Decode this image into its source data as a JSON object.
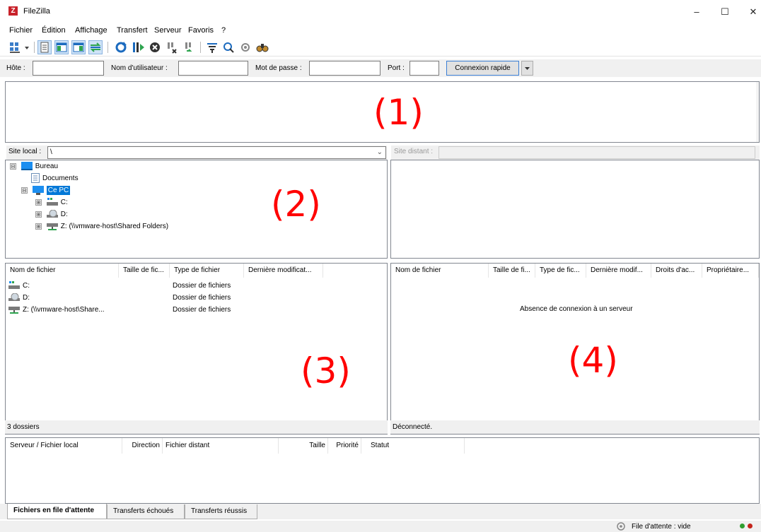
{
  "window": {
    "title": "FileZilla",
    "app_icon_letter": "Z",
    "controls": {
      "minimize": "–",
      "maximize": "☐",
      "close": "✕"
    }
  },
  "menu": [
    "Fichier",
    "Édition",
    "Affichage",
    "Transfert",
    "Serveur",
    "Favoris",
    "?"
  ],
  "toolbar": {
    "icons": [
      "site-manager-icon",
      "toggle-message-log-icon",
      "toggle-local-tree-icon",
      "toggle-remote-tree-icon",
      "toggle-queue-icon",
      "refresh-icon",
      "process-queue-icon",
      "cancel-icon",
      "disconnect-icon",
      "reconnect-icon",
      "directory-filter-icon",
      "compare-directories-icon",
      "sync-browse-icon",
      "search-files-icon"
    ]
  },
  "quickconnect": {
    "host_label": "Hôte :",
    "host_value": "",
    "user_label": "Nom d'utilisateur :",
    "user_value": "",
    "password_label": "Mot de passe :",
    "password_value": "",
    "port_label": "Port :",
    "port_value": "",
    "connect_button": "Connexion rapide"
  },
  "annotations": {
    "log": "(1)",
    "local_tree": "(2)",
    "local_files": "(3)",
    "remote_files": "(4)"
  },
  "local_site": {
    "label": "Site local :",
    "path": "\\",
    "tree": [
      {
        "label": "Bureau",
        "icon": "desktop-icon",
        "expander": "⊟"
      },
      {
        "label": "Documents",
        "icon": "documents-icon",
        "expander": ""
      },
      {
        "label": "Ce PC",
        "icon": "computer-icon",
        "expander": "⊟",
        "selected": true
      },
      {
        "label": "C:",
        "icon": "drive-c-icon",
        "expander": "⊞"
      },
      {
        "label": "D:",
        "icon": "cd-drive-icon",
        "expander": "⊞"
      },
      {
        "label": "Z: (\\\\vmware-host\\Shared Folders)",
        "icon": "network-drive-icon",
        "expander": "⊞"
      }
    ]
  },
  "remote_site": {
    "label": "Site distant :",
    "path": ""
  },
  "local_files": {
    "columns": [
      "Nom de fichier",
      "Taille de fic...",
      "Type de fichier",
      "Dernière modificat..."
    ],
    "rows": [
      {
        "name": "C:",
        "icon": "drive-c-icon",
        "size": "",
        "type": "Dossier de fichiers",
        "modified": ""
      },
      {
        "name": "D:",
        "icon": "cd-drive-icon",
        "size": "",
        "type": "Dossier de fichiers",
        "modified": ""
      },
      {
        "name": "Z: (\\\\vmware-host\\Share...",
        "icon": "network-drive-icon",
        "size": "",
        "type": "Dossier de fichiers",
        "modified": ""
      }
    ],
    "status": "3 dossiers"
  },
  "remote_files": {
    "columns": [
      "Nom de fichier",
      "Taille de fi...",
      "Type de fic...",
      "Dernière modif...",
      "Droits d'ac...",
      "Propriétaire..."
    ],
    "empty_message": "Absence de connexion à un serveur",
    "status": "Déconnecté."
  },
  "queue": {
    "columns": [
      "Serveur / Fichier local",
      "Direction",
      "Fichier distant",
      "Taille",
      "Priorité",
      "Statut"
    ],
    "tabs": [
      "Fichiers en file d'attente",
      "Transferts échoués",
      "Transferts réussis"
    ],
    "active_tab": 0
  },
  "statusbar": {
    "queue_text": "File d'attente : vide",
    "indicator_colors": [
      "#2f9e2f",
      "#c4241c"
    ]
  },
  "colors": {
    "selection": "#0078d7",
    "annotation": "#ff0000",
    "toolbar_blue": "#1c6bbf"
  }
}
